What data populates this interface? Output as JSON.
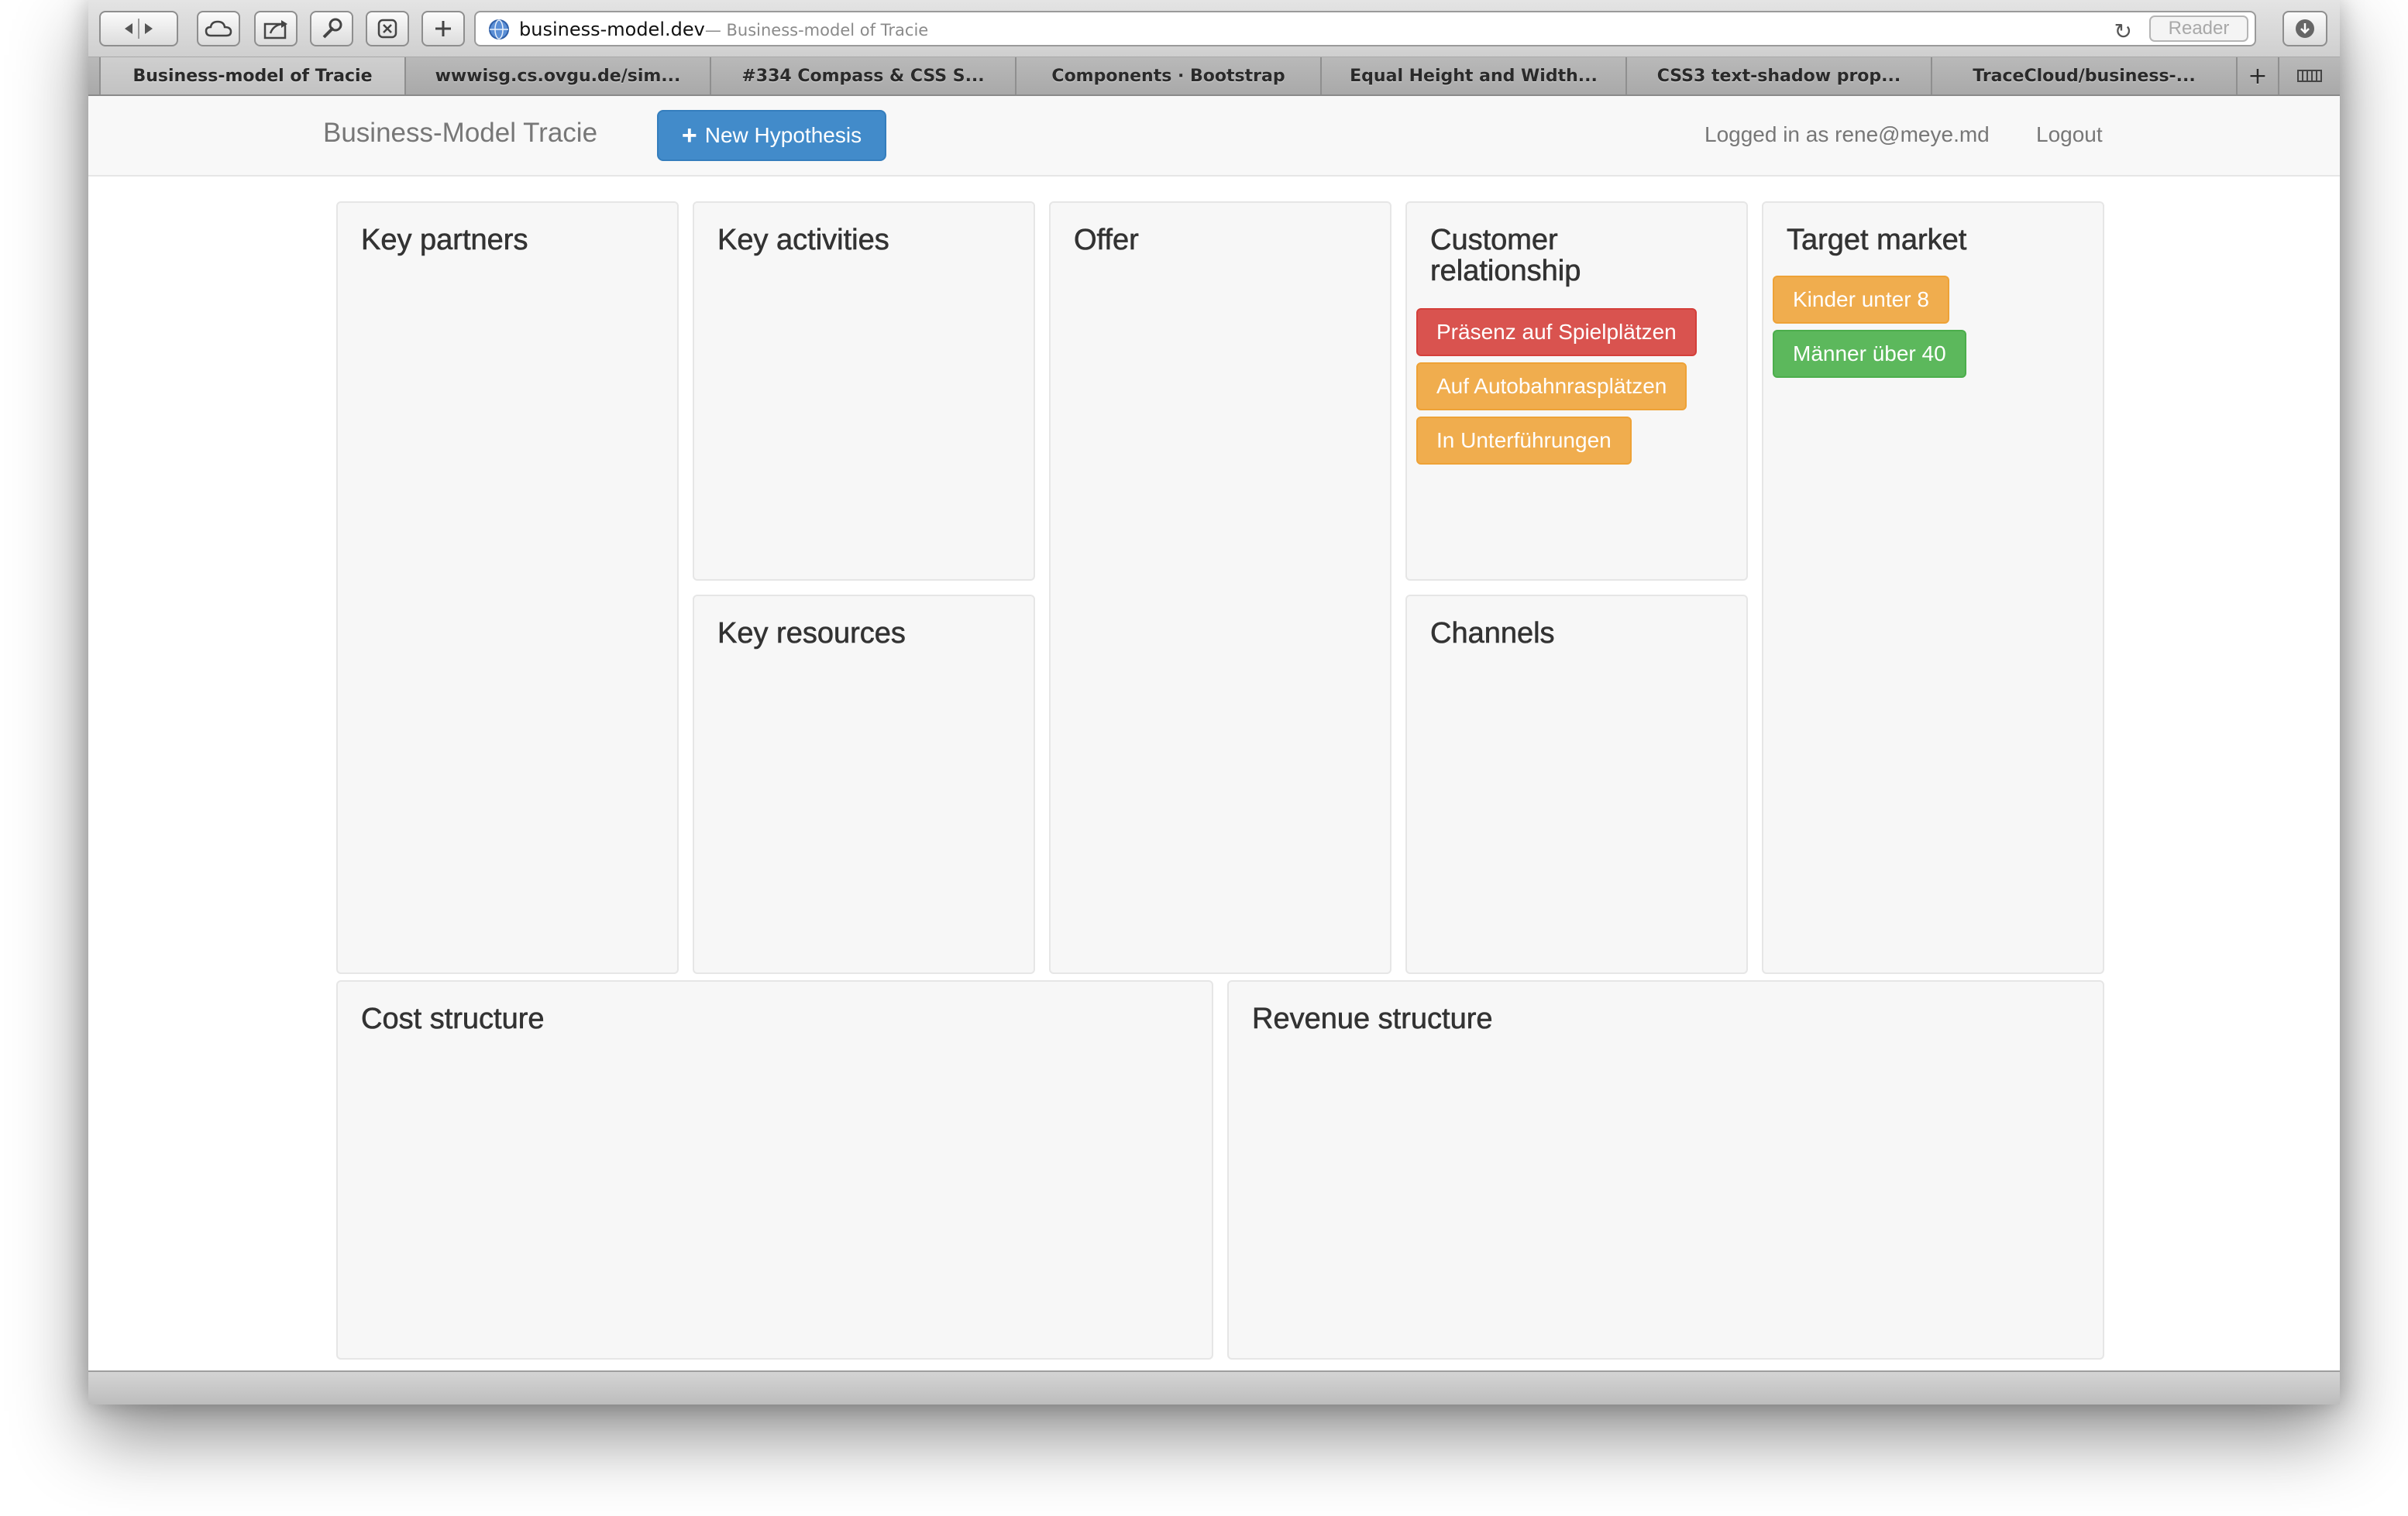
{
  "browser": {
    "url": "business-model.dev",
    "page_title_in_url": "— Business-model of Tracie",
    "reader_label": "Reader",
    "reload_icon": "reload-icon",
    "tabs": [
      {
        "label": "Business-model of Tracie",
        "active": true
      },
      {
        "label": "wwwisg.cs.ovgu.de/sim...",
        "active": false
      },
      {
        "label": "#334 Compass & CSS S...",
        "active": false
      },
      {
        "label": "Components · Bootstrap",
        "active": false
      },
      {
        "label": "Equal Height and Width...",
        "active": false
      },
      {
        "label": "CSS3 text-shadow prop...",
        "active": false
      },
      {
        "label": "TraceCloud/business-...",
        "active": false
      }
    ],
    "new_tab_label": "+"
  },
  "navbar": {
    "brand": "Business-Model Tracie",
    "new_hypothesis_label": "New Hypothesis",
    "logged_in_text": "Logged in as rene@meye.md",
    "logout_label": "Logout"
  },
  "canvas": {
    "key_partners": {
      "title": "Key partners"
    },
    "key_activities": {
      "title": "Key activities"
    },
    "key_resources": {
      "title": "Key resources"
    },
    "offer": {
      "title": "Offer"
    },
    "customer_relationship": {
      "title_line1": "Customer",
      "title_line2": "relationship",
      "notes": [
        {
          "label": "Präsenz auf Spielplätzen",
          "color": "#d9534f"
        },
        {
          "label": "Auf Autobahnrasplätzen",
          "color": "#f0ad4e"
        },
        {
          "label": "In Unterführungen",
          "color": "#f0ad4e"
        }
      ]
    },
    "channels": {
      "title": "Channels"
    },
    "target_market": {
      "title": "Target market",
      "notes": [
        {
          "label": "Kinder unter 8",
          "color": "#f0ad4e"
        },
        {
          "label": "Männer über 40",
          "color": "#5cb85c"
        }
      ]
    },
    "cost_structure": {
      "title": "Cost structure"
    },
    "revenue_structure": {
      "title": "Revenue structure"
    }
  },
  "colors": {
    "primary": "#428bca",
    "danger": "#d9534f",
    "warning": "#f0ad4e",
    "success": "#5cb85c"
  }
}
